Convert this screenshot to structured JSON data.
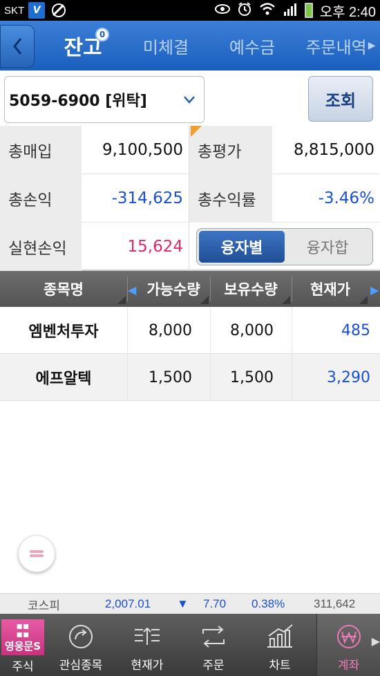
{
  "status_bar": {
    "carrier": "SKT",
    "app_badge": "V",
    "time": "오후 2:40",
    "icons": [
      "block-icon",
      "eye-icon",
      "alarm-icon",
      "wifi-icon",
      "signal-icon",
      "battery-icon"
    ]
  },
  "tabs": [
    {
      "label": "잔고",
      "active": true,
      "badge": "0"
    },
    {
      "label": "미체결",
      "active": false
    },
    {
      "label": "예수금",
      "active": false
    },
    {
      "label": "주문내역",
      "active": false
    }
  ],
  "tab_more_glyph": "▶",
  "account": {
    "selected": "5059-6900 [위탁]",
    "query_label": "조회"
  },
  "summary": {
    "total_purchase_label": "총매입",
    "total_purchase_value": "9,100,500",
    "total_eval_label": "총평가",
    "total_eval_value": "8,815,000",
    "total_pl_label": "총손익",
    "total_pl_value": "-314,625",
    "total_return_label": "총수익률",
    "total_return_value": "-3.46%",
    "realized_pl_label": "실현손익",
    "realized_pl_value": "15,624",
    "segment": [
      {
        "label": "융자별",
        "active": true
      },
      {
        "label": "융자합",
        "active": false
      }
    ]
  },
  "table": {
    "headers": [
      "종목명",
      "가능수량",
      "보유수량",
      "현재가"
    ],
    "rows": [
      {
        "name": "엠벤처투자",
        "available": "8,000",
        "held": "8,000",
        "price": "485"
      },
      {
        "name": "에프알텍",
        "available": "1,500",
        "held": "1,500",
        "price": "3,290"
      }
    ]
  },
  "ticker": {
    "index_name": "코스피",
    "index_value": "2,007.01",
    "direction_glyph": "▼",
    "change": "7.70",
    "change_pct": "0.38%",
    "volume": "311,642"
  },
  "bottom_nav": {
    "brand_text": "영웅문S",
    "items": [
      {
        "label": "주식",
        "icon": "brand-icon"
      },
      {
        "label": "관심종목",
        "icon": "watchlist-icon"
      },
      {
        "label": "현재가",
        "icon": "current-price-icon"
      },
      {
        "label": "주문",
        "icon": "order-icon"
      },
      {
        "label": "차트",
        "icon": "chart-icon"
      },
      {
        "label": "계좌",
        "icon": "account-won-icon",
        "active": true
      }
    ]
  },
  "colors": {
    "tab_bar": "#1a5fbd",
    "negative": "#1b4fd1",
    "positive": "#e0266f",
    "brand": "#d63c8c"
  }
}
